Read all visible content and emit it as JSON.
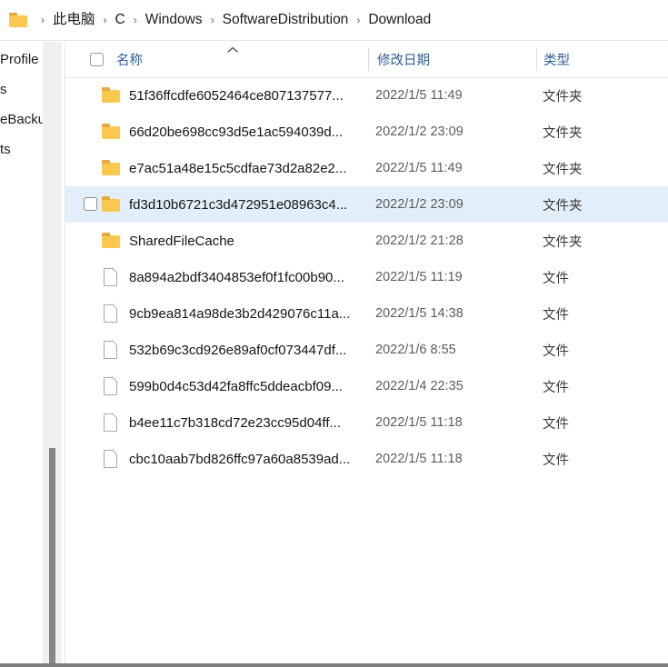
{
  "breadcrumb": {
    "folder_icon": "folder-icon",
    "separator": "›",
    "items": [
      {
        "label": "此电脑"
      },
      {
        "label": "C"
      },
      {
        "label": "Windows"
      },
      {
        "label": "SoftwareDistribution"
      },
      {
        "label": "Download"
      }
    ]
  },
  "sidebar": {
    "items": [
      {
        "label": "Profile"
      },
      {
        "label": "s"
      },
      {
        "label": "eBacku"
      },
      {
        "label": "ts"
      }
    ],
    "scrollbar": {
      "name": "vertical-scrollbar"
    }
  },
  "columns": {
    "name": "名称",
    "date_modified": "修改日期",
    "type": "类型",
    "sort_indicator": "chevron-up-icon"
  },
  "files": [
    {
      "name": "51f36ffcdfe6052464ce807137577...",
      "date": "2022/1/5 11:49",
      "type": "文件夹",
      "kind": "folder",
      "selected": false
    },
    {
      "name": "66d20be698cc93d5e1ac594039d...",
      "date": "2022/1/2 23:09",
      "type": "文件夹",
      "kind": "folder",
      "selected": false
    },
    {
      "name": "e7ac51a48e15c5cdfae73d2a82e2...",
      "date": "2022/1/5 11:49",
      "type": "文件夹",
      "kind": "folder",
      "selected": false
    },
    {
      "name": "fd3d10b6721c3d472951e08963c4...",
      "date": "2022/1/2 23:09",
      "type": "文件夹",
      "kind": "folder",
      "selected": true
    },
    {
      "name": "SharedFileCache",
      "date": "2022/1/2 21:28",
      "type": "文件夹",
      "kind": "folder",
      "selected": false
    },
    {
      "name": "8a894a2bdf3404853ef0f1fc00b90...",
      "date": "2022/1/5 11:19",
      "type": "文件",
      "kind": "file",
      "selected": false
    },
    {
      "name": "9cb9ea814a98de3b2d429076c11a...",
      "date": "2022/1/5 14:38",
      "type": "文件",
      "kind": "file",
      "selected": false
    },
    {
      "name": "532b69c3cd926e89af0cf073447df...",
      "date": "2022/1/6 8:55",
      "type": "文件",
      "kind": "file",
      "selected": false
    },
    {
      "name": "599b0d4c53d42fa8ffc5ddeacbf09...",
      "date": "2022/1/4 22:35",
      "type": "文件",
      "kind": "file",
      "selected": false
    },
    {
      "name": "b4ee11c7b318cd72e23cc95d04ff...",
      "date": "2022/1/5 11:18",
      "type": "文件",
      "kind": "file",
      "selected": false
    },
    {
      "name": "cbc10aab7bd826ffc97a60a8539ad...",
      "date": "2022/1/5 11:18",
      "type": "文件",
      "kind": "file",
      "selected": false
    }
  ],
  "colors": {
    "selection": "#e2effa",
    "header_text": "#32609a",
    "folder_icon": "#fbc84f",
    "folder_icon_tab": "#e9a93a",
    "scrollbar_thumb": "#868686"
  }
}
